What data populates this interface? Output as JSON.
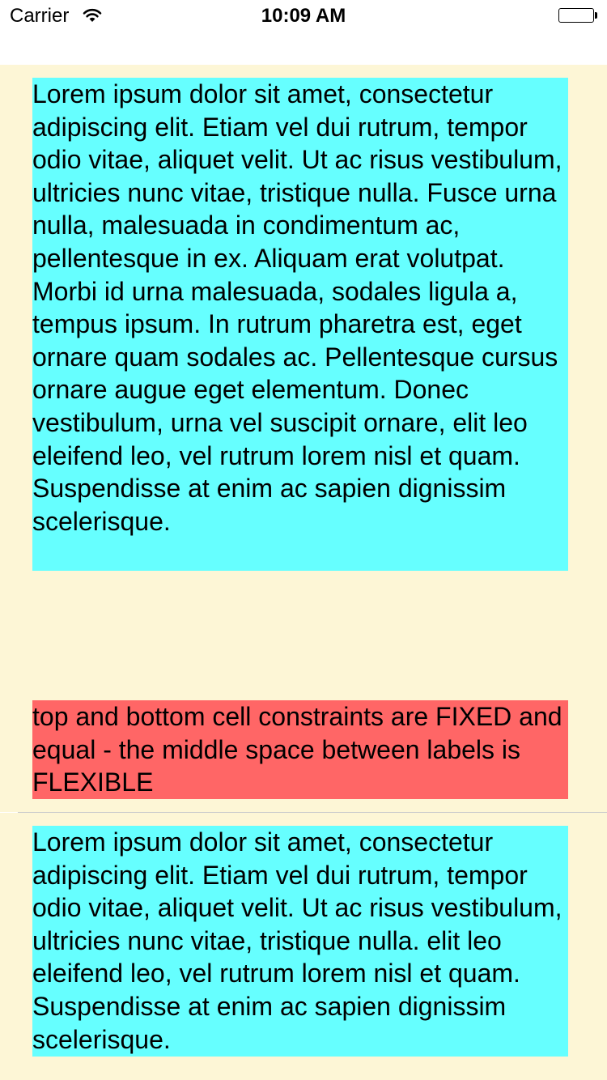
{
  "status_bar": {
    "carrier": "Carrier",
    "time": "10:09 AM",
    "wifi_icon": "wifi-icon",
    "battery_icon": "battery-icon"
  },
  "colors": {
    "cell_background": "#fdf6d6",
    "cyan_label": "#66ffff",
    "red_label": "#ff6666"
  },
  "cells": [
    {
      "top_label": "Lorem ipsum dolor sit amet, consectetur adipiscing elit. Etiam vel dui rutrum, tempor odio vitae, aliquet velit. Ut ac risus vestibulum, ultricies nunc vitae, tristique nulla. Fusce urna nulla, malesuada in condimentum ac, pellentesque in ex. Aliquam erat volutpat. Morbi id urna malesuada, sodales ligula a, tempus ipsum. In rutrum pharetra est, eget ornare quam sodales ac. Pellentesque cursus ornare augue eget elementum. Donec vestibulum, urna vel suscipit ornare, elit leo eleifend leo, vel rutrum lorem nisl et quam. Suspendisse at enim ac sapien dignissim scelerisque.",
      "bottom_label": "top and bottom cell constraints are FIXED and equal - the middle space between labels is FLEXIBLE"
    },
    {
      "top_label": "Lorem ipsum dolor sit amet, consectetur adipiscing elit. Etiam vel dui rutrum, tempor odio vitae, aliquet velit. Ut ac risus vestibulum, ultricies nunc vitae, tristique nulla. elit leo eleifend leo, vel rutrum lorem nisl et quam. Suspendisse at enim ac sapien dignissim scelerisque."
    }
  ]
}
